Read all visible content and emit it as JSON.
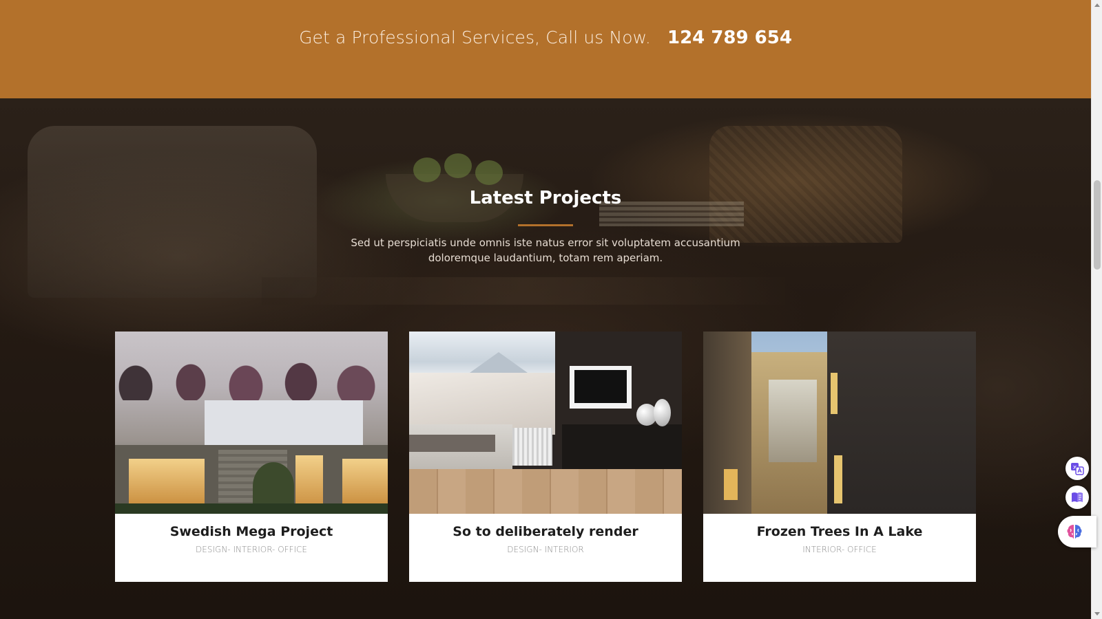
{
  "cta": {
    "text": "Get a Professional Services, Call us Now.",
    "phone": "124 789 654",
    "background": "#b3712b"
  },
  "projects": {
    "title": "Latest Projects",
    "description": "Sed ut perspiciatis unde omnis iste natus error sit voluptatem accusantium doloremque laudantium, totam rem aperiam.",
    "accent": "#b3712b",
    "cards": [
      {
        "title": "Swedish Mega Project",
        "tags": "DESIGN- INTERIOR- OFFICE",
        "image": "modern-house-photo"
      },
      {
        "title": "So to deliberately render",
        "tags": "DESIGN- INTERIOR",
        "image": "bedroom-photo"
      },
      {
        "title": "Frozen Trees In A Lake",
        "tags": "INTERIOR- OFFICE",
        "image": "building-alley-photo"
      }
    ]
  },
  "widgets": {
    "translate_icon": "translate-icon",
    "reader_icon": "book-icon",
    "assistant_icon": "brain-icon"
  }
}
